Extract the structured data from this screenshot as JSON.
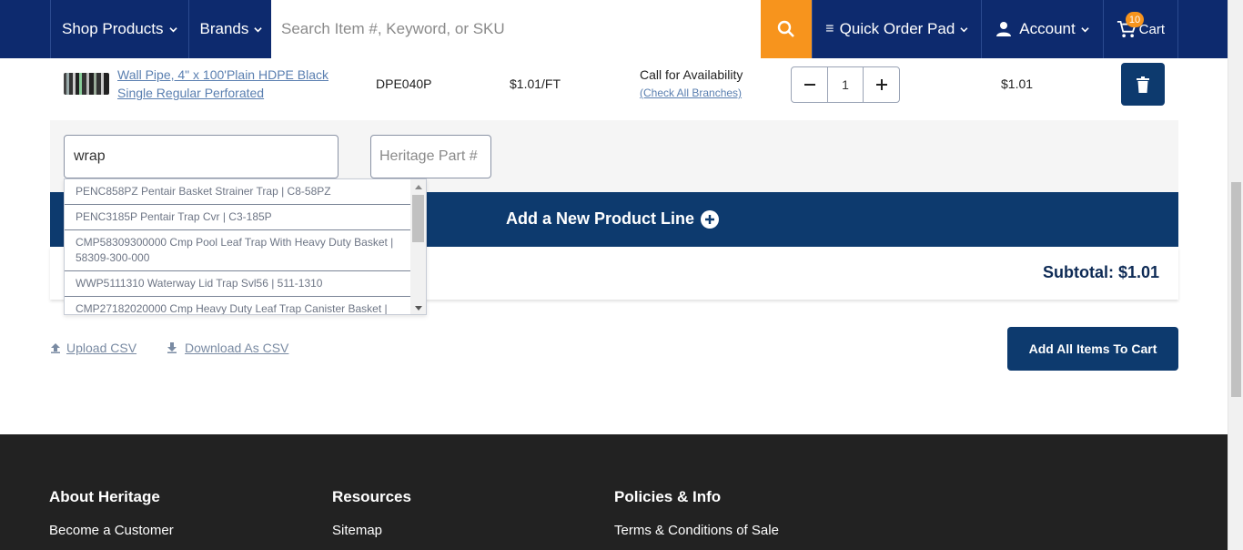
{
  "header": {
    "shop_products": "Shop Products",
    "brands": "Brands",
    "search_placeholder": "Search Item #, Keyword, or SKU",
    "quick_order_pad": "Quick Order Pad",
    "account": "Account",
    "cart": "Cart",
    "cart_count": "10",
    "colors": {
      "navy": "#0d2a6e",
      "orange": "#f7941d"
    }
  },
  "product_row": {
    "name": "Wall Pipe, 4\" x 100'Plain HDPE Black Single Regular Perforated",
    "sku": "DPE040P",
    "price": "$1.01/FT",
    "availability": "Call for Availability",
    "check_branches": "(Check All Branches)",
    "quantity": "1",
    "total": "$1.01"
  },
  "entry": {
    "search_value": "wrap",
    "part_placeholder": "Heritage Part #"
  },
  "dropdown": {
    "items": [
      "PENC858PZ Pentair Basket Strainer Trap | C8-58PZ",
      "PENC3185P Pentair Trap Cvr | C3-185P",
      "CMP58309300000 Cmp Pool Leaf Trap With Heavy Duty Basket | 58309-300-000",
      "WWP5111310 Waterway Lid Trap Svl56 | 511-1310",
      "CMP27182020000 Cmp Heavy Duty Leaf Trap Canister Basket |"
    ]
  },
  "add_line": "Add a New Product Line",
  "subtotal": "Subtotal: $1.01",
  "csv": {
    "upload": "Upload CSV",
    "download": "Download As CSV"
  },
  "add_all": "Add All Items To Cart",
  "footer": {
    "col1_head": "About Heritage",
    "col1_link": "Become a Customer",
    "col2_head": "Resources",
    "col2_link": "Sitemap",
    "col3_head": "Policies & Info",
    "col3_link": "Terms & Conditions of Sale"
  }
}
